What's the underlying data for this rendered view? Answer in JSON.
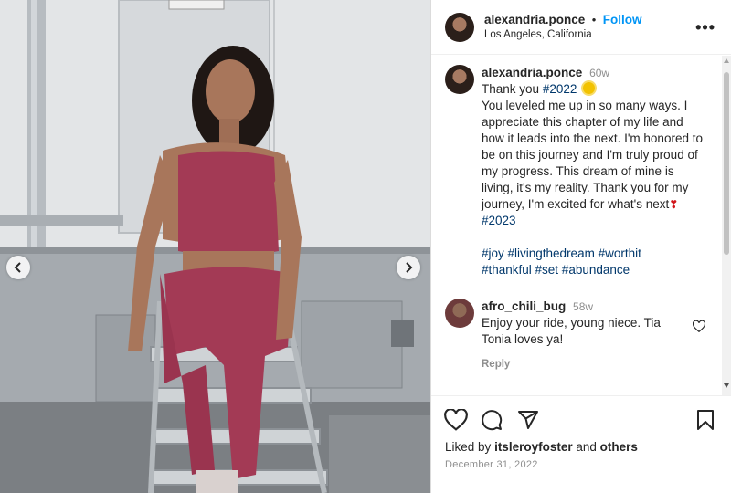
{
  "post": {
    "username": "alexandria.ponce",
    "separator": "•",
    "follow_label": "Follow",
    "location": "Los Angeles, California",
    "more_icon": "more-options-icon"
  },
  "caption": {
    "username": "alexandria.ponce",
    "time": "60w",
    "thank_you": "Thank you",
    "hashtag_2022": "#2022",
    "body": "You leveled me up in so many ways. I appreciate this chapter of my life and how it leads into the next. I'm honored to be on this journey and I'm truly proud of my progress. This dream of mine is living, it's my reality. Thank you for my journey, I'm excited for what's next",
    "hashtag_2023": "#2023",
    "hashtags_line1": "#joy #livingthedream #worthit",
    "hashtags_line2": "#thankful #set #abundance"
  },
  "comments": [
    {
      "username": "afro_chili_bug",
      "time": "58w",
      "text": "Enjoy your ride, young niece. Tia Tonia loves ya!",
      "reply_label": "Reply"
    }
  ],
  "actions": {
    "liked_prefix": "Liked by",
    "liked_user": "itsleroyfoster",
    "liked_and": "and",
    "liked_others": "others",
    "date": "December 31, 2022"
  },
  "colors": {
    "follow": "#0095f6",
    "hashtag": "#00376b",
    "outfit": "#a33a55"
  }
}
